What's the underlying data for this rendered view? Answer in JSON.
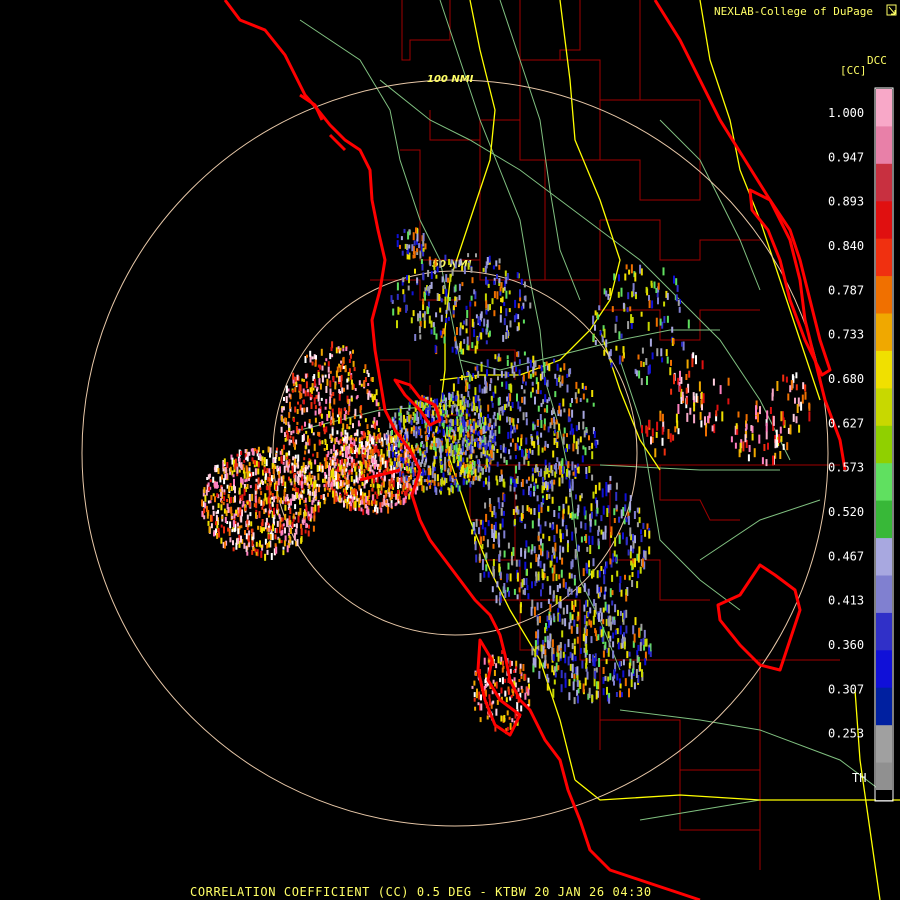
{
  "header": {
    "credit": "NEXLAB-College of DuPage",
    "logo_icon": "nexlab-logo-icon"
  },
  "legend": {
    "product_code": "DCC",
    "unit": "[CC]",
    "labels": [
      "1.000",
      "0.947",
      "0.893",
      "0.840",
      "0.787",
      "0.733",
      "0.680",
      "0.627",
      "0.573",
      "0.520",
      "0.467",
      "0.413",
      "0.360",
      "0.307",
      "0.253",
      "TH"
    ],
    "colors": [
      "#f8a8c8",
      "#e880a8",
      "#c83040",
      "#e01010",
      "#f03010",
      "#f07000",
      "#f0a800",
      "#f0e000",
      "#c8d800",
      "#90d000",
      "#60e060",
      "#38b838",
      "#a8a8e0",
      "#8080d0",
      "#3030c8",
      "#1010d8",
      "#0020a0",
      "#a0a0a0",
      "#909090"
    ]
  },
  "rings": {
    "inner_label": "50 NMI",
    "outer_label": "100 NMI"
  },
  "footer": {
    "caption": "CORRELATION COEFFICIENT (CC) 0.5 DEG - KTBW 20 JAN 26 04:30"
  },
  "colors": {
    "coastline": "#ff0000",
    "county_lines": "#a00000",
    "highways": "#ffff00",
    "roads": "#80c080",
    "range_rings": "#e8c8a8",
    "text": "#ffff66"
  }
}
